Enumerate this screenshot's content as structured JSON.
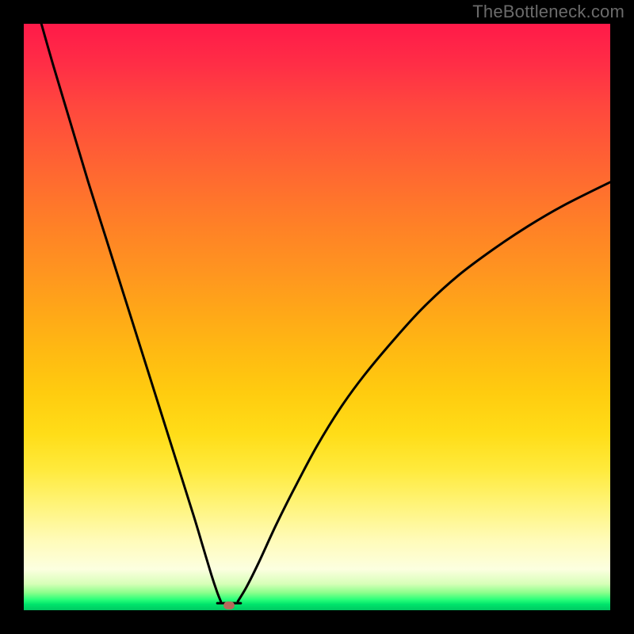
{
  "watermark": "TheBottleneck.com",
  "colors": {
    "page_bg": "#000000",
    "gradient_top": "#ff1a49",
    "gradient_mid": "#ffcc0f",
    "gradient_low": "#fffbb8",
    "gradient_bottom": "#00c862",
    "curve_stroke": "#000000",
    "marker_fill": "#b66a5c",
    "watermark_text": "#6b6b6b"
  },
  "chart_data": {
    "type": "line",
    "title": "",
    "xlabel": "",
    "ylabel": "",
    "xlim": [
      0,
      100
    ],
    "ylim": [
      0,
      100
    ],
    "grid": false,
    "legend": false,
    "series": [
      {
        "name": "left-branch",
        "x": [
          3,
          5,
          8,
          11,
          14,
          17,
          20,
          23,
          26,
          29,
          30.5,
          32,
          33,
          33.6
        ],
        "y": [
          100,
          93,
          83,
          73,
          63.5,
          54,
          44.5,
          35,
          25.5,
          16,
          11,
          6,
          3,
          1.5
        ]
      },
      {
        "name": "right-branch",
        "x": [
          36.5,
          38,
          40,
          43,
          46,
          50,
          54,
          58,
          63,
          68,
          74,
          80,
          86,
          92,
          100
        ],
        "y": [
          1.5,
          4,
          8,
          14.5,
          20.5,
          28,
          34.5,
          40,
          46,
          51.5,
          57,
          61.5,
          65.5,
          69,
          73
        ]
      }
    ],
    "annotations": [
      {
        "name": "min-marker",
        "x": 35,
        "y": 0.8,
        "shape": "pill",
        "color": "#b66a5c"
      }
    ],
    "minimum_region": {
      "x_start": 33,
      "x_end": 37,
      "y": 1.2
    }
  }
}
